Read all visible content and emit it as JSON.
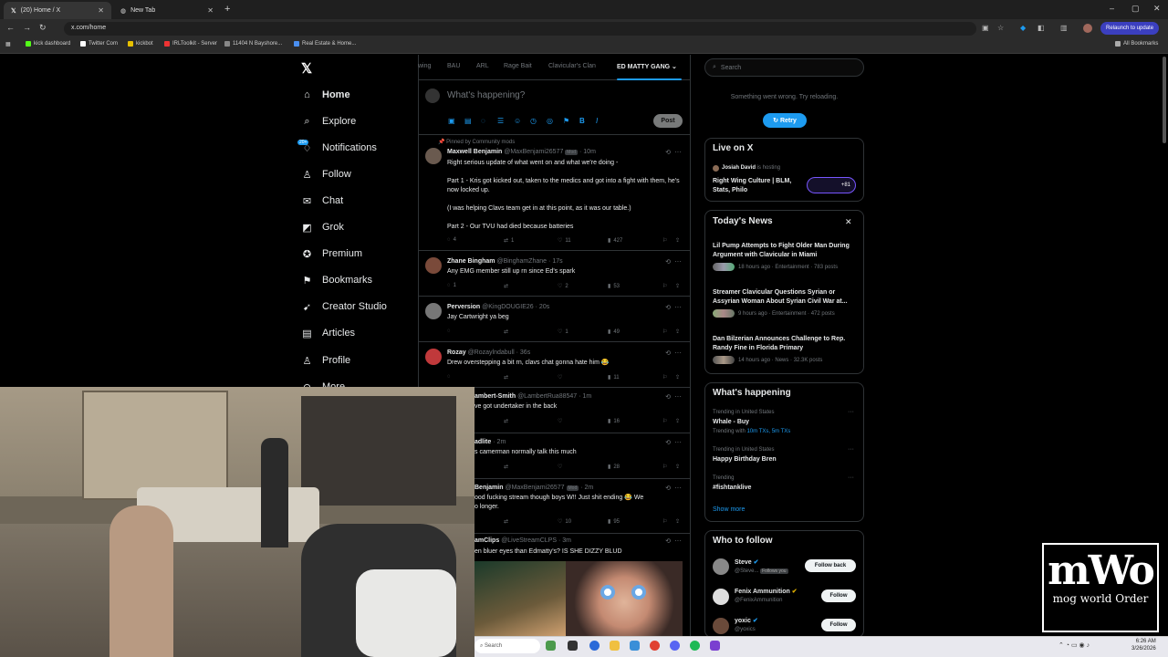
{
  "browser": {
    "tabs": [
      {
        "title": "(20) Home / X",
        "active": true
      },
      {
        "title": "New Tab",
        "active": false
      }
    ],
    "url": "x.com/home",
    "relaunch": "Relaunch to update",
    "bookmarks": [
      "kick dashboard",
      "Twitter Com",
      "kickbot",
      "IRLToolkit - Server",
      "11404 N Bayshore...",
      "Real Estate & Home..."
    ],
    "all_bookmarks": "All Bookmarks"
  },
  "nav": {
    "logo": "X",
    "items": [
      "Home",
      "Explore",
      "Notifications",
      "Follow",
      "Chat",
      "Grok",
      "Premium",
      "Bookmarks",
      "Creator Studio",
      "Articles",
      "Profile",
      "More"
    ],
    "notif_badge": "20+"
  },
  "feed": {
    "tabs": [
      "wing",
      "BAU",
      "ARL",
      "Rage Bait",
      "Clavicular's Clan",
      "ED MATTY GANG"
    ],
    "composer_placeholder": "What's happening?",
    "post_label": "Post",
    "pinned_label": "Pinned by Community mods",
    "tweets": [
      {
        "name": "Maxwell Benjamin",
        "handle": "@MaxBenjami26577",
        "mod": "Mod",
        "time": "10m",
        "text": [
          "Right serious update of what went on and what we're doing -",
          "Part 1 - Kris got kicked out, taken to the medics and got into a fight with them, he's now locked up.",
          "(I was helping Clavs team get in at this point, as it was our table.)",
          "Part 2 - Our TVU had died because batteries"
        ],
        "replies": "4",
        "reposts": "1",
        "likes": "11",
        "views": "427"
      },
      {
        "name": "Zhane Bingham",
        "handle": "@BinghamZhane",
        "time": "17s",
        "text": [
          "Any EMG member still up rn since Ed's spark"
        ],
        "replies": "1",
        "reposts": "",
        "likes": "2",
        "views": "53"
      },
      {
        "name": "Perversion",
        "handle": "@KingDOUGIE26",
        "time": "20s",
        "text": [
          "Jay Cartwright ya beg"
        ],
        "replies": "",
        "reposts": "",
        "likes": "1",
        "views": "49"
      },
      {
        "name": "Rozay",
        "handle": "@Rozaylndabull",
        "time": "36s",
        "text": [
          "Drew overstepping a bit rn, clavs chat gonna hate him 😂"
        ],
        "replies": "",
        "reposts": "",
        "likes": "",
        "views": "11"
      },
      {
        "name": "ambert-Smith",
        "handle": "@LambertRua88547",
        "time": "1m",
        "text": [
          "ve got undertaker in the back"
        ],
        "replies": "",
        "reposts": "",
        "likes": "",
        "views": "16"
      },
      {
        "name": "adlite",
        "handle": "",
        "time": "2m",
        "text": [
          "s camerman normally talk this much"
        ],
        "replies": "",
        "reposts": "",
        "likes": "",
        "views": "28"
      },
      {
        "name": "Benjamin",
        "handle": "@MaxBenjami26577",
        "mod": "Mod",
        "time": "2m",
        "text": [
          "ood fucking stream though boys W!! Just shit ending 😂 We",
          "o longer."
        ],
        "replies": "",
        "reposts": "",
        "likes": "10",
        "views": "95"
      },
      {
        "name": "amClips",
        "handle": "@LiveStreamCLPS",
        "time": "3m",
        "text": [
          "en bluer eyes than Edmatty's? IS SHE DIZZY BLUD"
        ],
        "replies": "",
        "reposts": "",
        "likes": "",
        "views": ""
      }
    ]
  },
  "right": {
    "search_placeholder": "Search",
    "error": "Something went wrong. Try reloading.",
    "retry": "Retry",
    "live": {
      "title": "Live on X",
      "host": "Josiah David",
      "hosting": "is hosting",
      "topic": "Right Wing Culture | BLM, Stats, Philo",
      "count": "+81"
    },
    "news": {
      "title": "Today's News",
      "items": [
        {
          "headline": "Lil Pump Attempts to Fight Older Man During Argument with Clavicular in Miami",
          "meta": "18 hours ago · Entertainment · 783 posts"
        },
        {
          "headline": "Streamer Clavicular Questions Syrian or Assyrian Woman About Syrian Civil War at...",
          "meta": "9 hours ago · Entertainment · 472 posts"
        },
        {
          "headline": "Dan Bilzerian Announces Challenge to Rep. Randy Fine in Florida Primary",
          "meta": "14 hours ago · News · 32.3K posts"
        }
      ]
    },
    "happening": {
      "title": "What's happening",
      "items": [
        {
          "context": "Trending in United States",
          "topic": "Whale - Buy",
          "extra_prefix": "Trending with",
          "extra": "10m TXs, 5m TXs"
        },
        {
          "context": "Trending in United States",
          "topic": "Happy Birthday Bren"
        },
        {
          "context": "Trending",
          "topic": "#fishtanklive"
        }
      ],
      "show_more": "Show more"
    },
    "who": {
      "title": "Who to follow",
      "items": [
        {
          "name": "Steve",
          "handle": "@Steve...",
          "follows_you": "Follows you",
          "action": "Follow back"
        },
        {
          "name": "Fenix Ammunition",
          "handle": "@FenixAmmunition",
          "action": "Follow"
        },
        {
          "name": "yoxic",
          "handle": "@yoxics",
          "action": "Follow"
        }
      ]
    }
  },
  "overlay": {
    "logo": "mWo",
    "subtitle": "mog world Order"
  },
  "taskbar": {
    "search": "Search",
    "time": "6:26 AM",
    "date": "3/26/2026"
  }
}
